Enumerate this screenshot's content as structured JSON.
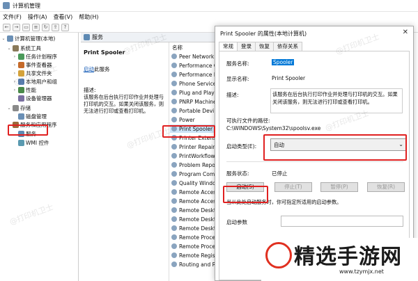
{
  "window": {
    "title": "计算机管理"
  },
  "menu": [
    "文件(F)",
    "操作(A)",
    "查看(V)",
    "帮助(H)"
  ],
  "tree": [
    {
      "label": "计算机管理(本地)",
      "level": 0,
      "exp": "⌄"
    },
    {
      "label": "系统工具",
      "level": 1,
      "exp": "⌄"
    },
    {
      "label": "任务计划程序",
      "level": 2,
      "exp": "›"
    },
    {
      "label": "事件查看器",
      "level": 2,
      "exp": "›"
    },
    {
      "label": "共享文件夹",
      "level": 2,
      "exp": "›"
    },
    {
      "label": "本地用户和组",
      "level": 2,
      "exp": "›"
    },
    {
      "label": "性能",
      "level": 2,
      "exp": "›"
    },
    {
      "label": "设备管理器",
      "level": 2,
      "exp": ""
    },
    {
      "label": "存储",
      "level": 1,
      "exp": "⌄"
    },
    {
      "label": "磁盘管理",
      "level": 2,
      "exp": ""
    },
    {
      "label": "服务和应用程序",
      "level": 1,
      "exp": "⌄"
    },
    {
      "label": "服务",
      "level": 2,
      "exp": ""
    },
    {
      "label": "WMI 控件",
      "level": 2,
      "exp": ""
    }
  ],
  "services_pane": {
    "header": "服务",
    "selected_name": "Print Spooler",
    "start_link": "启动",
    "start_suffix": "此服务",
    "desc_label": "描述:",
    "desc_text": "该服务在后台执行打印作业并处理与打印机的交互。如果关闭该服务，则无法进行打印或查看打印机。",
    "col_header": "名称",
    "items": [
      "Peer Network",
      "Performance C",
      "Performance L",
      "Phone Service",
      "Plug and Play",
      "PNRP Machine",
      "Portable Devi",
      "Power",
      "Print Spooler",
      "Printer Extensi",
      "Printer Repair",
      "PrintWorkflow",
      "Problem Repor",
      "Program Com",
      "Quality Windo",
      "Remote Access",
      "Remote Access",
      "Remote Deskt",
      "Remote Deskt",
      "Remote Deskt",
      "Remote Proce",
      "Remote Proce",
      "Remote Regis",
      "Routing and R"
    ]
  },
  "dialog": {
    "title": "Print Spooler 的属性(本地计算机)",
    "close": "✕",
    "tabs": [
      "常规",
      "登录",
      "恢复",
      "依存关系"
    ],
    "service_name_label": "服务名称:",
    "service_name": "Spooler",
    "display_name_label": "显示名称:",
    "display_name": "Print Spooler",
    "desc_label": "描述:",
    "desc": "该服务在后台执行打印作业并处理与打印机的交互。如果关闭该服务，则无法进行打印或查看打印机。",
    "path_label": "可执行文件的路径:",
    "path": "C:\\WINDOWS\\System32\\spoolsv.exe",
    "startup_label": "启动类型(E):",
    "startup_value": "自动",
    "status_label": "服务状态:",
    "status_value": "已停止",
    "buttons": {
      "start": "启动(S)",
      "stop": "停止(T)",
      "pause": "暂停(P)",
      "resume": "恢复(R)"
    },
    "hint": "当从此处启动服务时，你可指定所适用的启动参数。",
    "params_label": "启动参数"
  },
  "watermarks": [
    "@打印机卫士",
    "@打印机卫士",
    "@打印机卫士",
    "@打印机卫士",
    "@打印机卫士",
    "@打印机卫士"
  ],
  "logo": {
    "text": "精选手游网",
    "url": "www.tzymjx.net"
  },
  "colors": {
    "highlight": "#e02020",
    "selection": "#cce4f7",
    "link": "#0b55b4"
  }
}
